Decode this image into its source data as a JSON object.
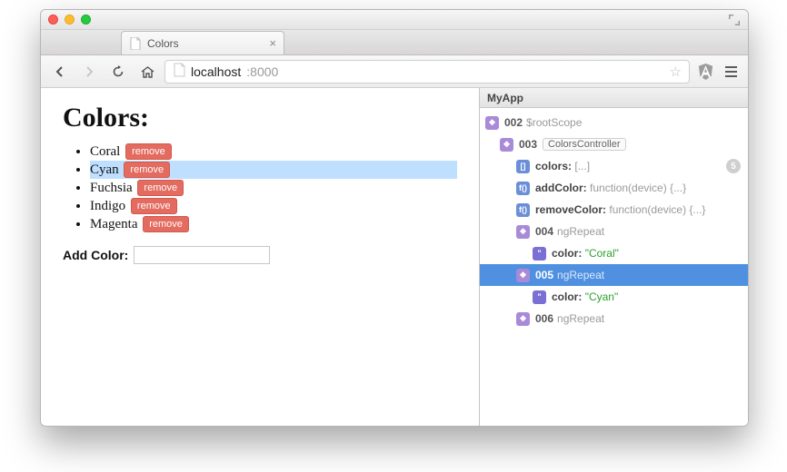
{
  "browser": {
    "tab_title": "Colors",
    "url_host": "localhost",
    "url_port": ":8000"
  },
  "page": {
    "heading": "Colors:",
    "colors": [
      {
        "name": "Coral",
        "selected": false
      },
      {
        "name": "Cyan",
        "selected": true
      },
      {
        "name": "Fuchsia",
        "selected": false
      },
      {
        "name": "Indigo",
        "selected": false
      },
      {
        "name": "Magenta",
        "selected": false
      }
    ],
    "remove_label": "remove",
    "add_label": "Add Color:",
    "add_value": ""
  },
  "devtools": {
    "app_name": "MyApp",
    "tree": {
      "root_id": "002",
      "root_label": "$rootScope",
      "ctrl_id": "003",
      "ctrl_name": "ColorsController",
      "props": {
        "colors_key": "colors:",
        "colors_val": "[...]",
        "colors_count": "5",
        "addColor_key": "addColor:",
        "addColor_val": "function(device) {...}",
        "removeColor_key": "removeColor:",
        "removeColor_val": "function(device) {...}"
      },
      "repeats": [
        {
          "id": "004",
          "label": "ngRepeat",
          "color": "Coral",
          "selected": false
        },
        {
          "id": "005",
          "label": "ngRepeat",
          "color": "Cyan",
          "selected": true
        },
        {
          "id": "006",
          "label": "ngRepeat",
          "color": null,
          "selected": false
        }
      ],
      "color_key": "color:"
    }
  }
}
